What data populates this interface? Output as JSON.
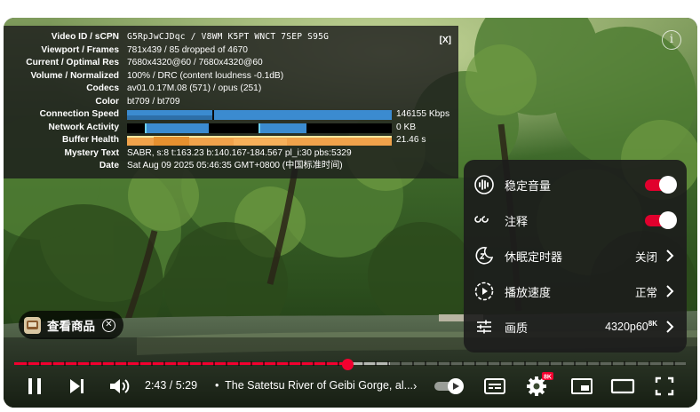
{
  "stats": {
    "close_label": "[X]",
    "rows": [
      {
        "key": "Video ID / sCPN",
        "value": "G5RpJwCJDqc  /  V8WM  K5PT  WNCT  7SEP  S95G"
      },
      {
        "key": "Viewport / Frames",
        "value": "781x439 / 85 dropped of 4670"
      },
      {
        "key": "Current / Optimal Res",
        "value": "7680x4320@60 / 7680x4320@60"
      },
      {
        "key": "Volume / Normalized",
        "value": "100% / DRC (content loudness -0.1dB)"
      },
      {
        "key": "Codecs",
        "value": "av01.0.17M.08 (571) / opus (251)"
      },
      {
        "key": "Color",
        "value": "bt709 / bt709"
      },
      {
        "key": "Connection Speed",
        "value": "146155 Kbps"
      },
      {
        "key": "Network Activity",
        "value": "0 KB"
      },
      {
        "key": "Buffer Health",
        "value": "21.46 s"
      },
      {
        "key": "Mystery Text",
        "value": "SABR, s:8 t:163.23 b:140.167-184.567 pl_i:30 pbs:5329"
      },
      {
        "key": "Date",
        "value": "Sat Aug 09 2025 05:46:35 GMT+0800 (中国标准时间)"
      }
    ]
  },
  "info_icon": "info-icon",
  "shop_chip": {
    "label": "查看商品",
    "close_icon": "close-icon"
  },
  "settings_menu": {
    "items": [
      {
        "icon": "stable-volume-icon",
        "label": "稳定音量",
        "control": "toggle",
        "on": true
      },
      {
        "icon": "captions-icon",
        "label": "注释",
        "control": "toggle",
        "on": true
      },
      {
        "icon": "sleep-timer-icon",
        "label": "休眠定时器",
        "value": "关闭"
      },
      {
        "icon": "playback-speed-icon",
        "label": "播放速度",
        "value": "正常"
      },
      {
        "icon": "quality-icon",
        "label": "画质",
        "value": "4320p60",
        "badge": "8K"
      }
    ]
  },
  "player": {
    "current_time": "2:43",
    "duration": "5:29",
    "time_display": "2:43 / 5:29",
    "separator": "•",
    "video_title": "The Satetsu River of Geibi Gorge, al...",
    "title_chevron": "›",
    "progress_fraction": 0.4954,
    "buffered_fraction": 0.56,
    "settings_badge": "8K",
    "accent_color": "#f2002f",
    "toggle_color": "#e1002d"
  }
}
